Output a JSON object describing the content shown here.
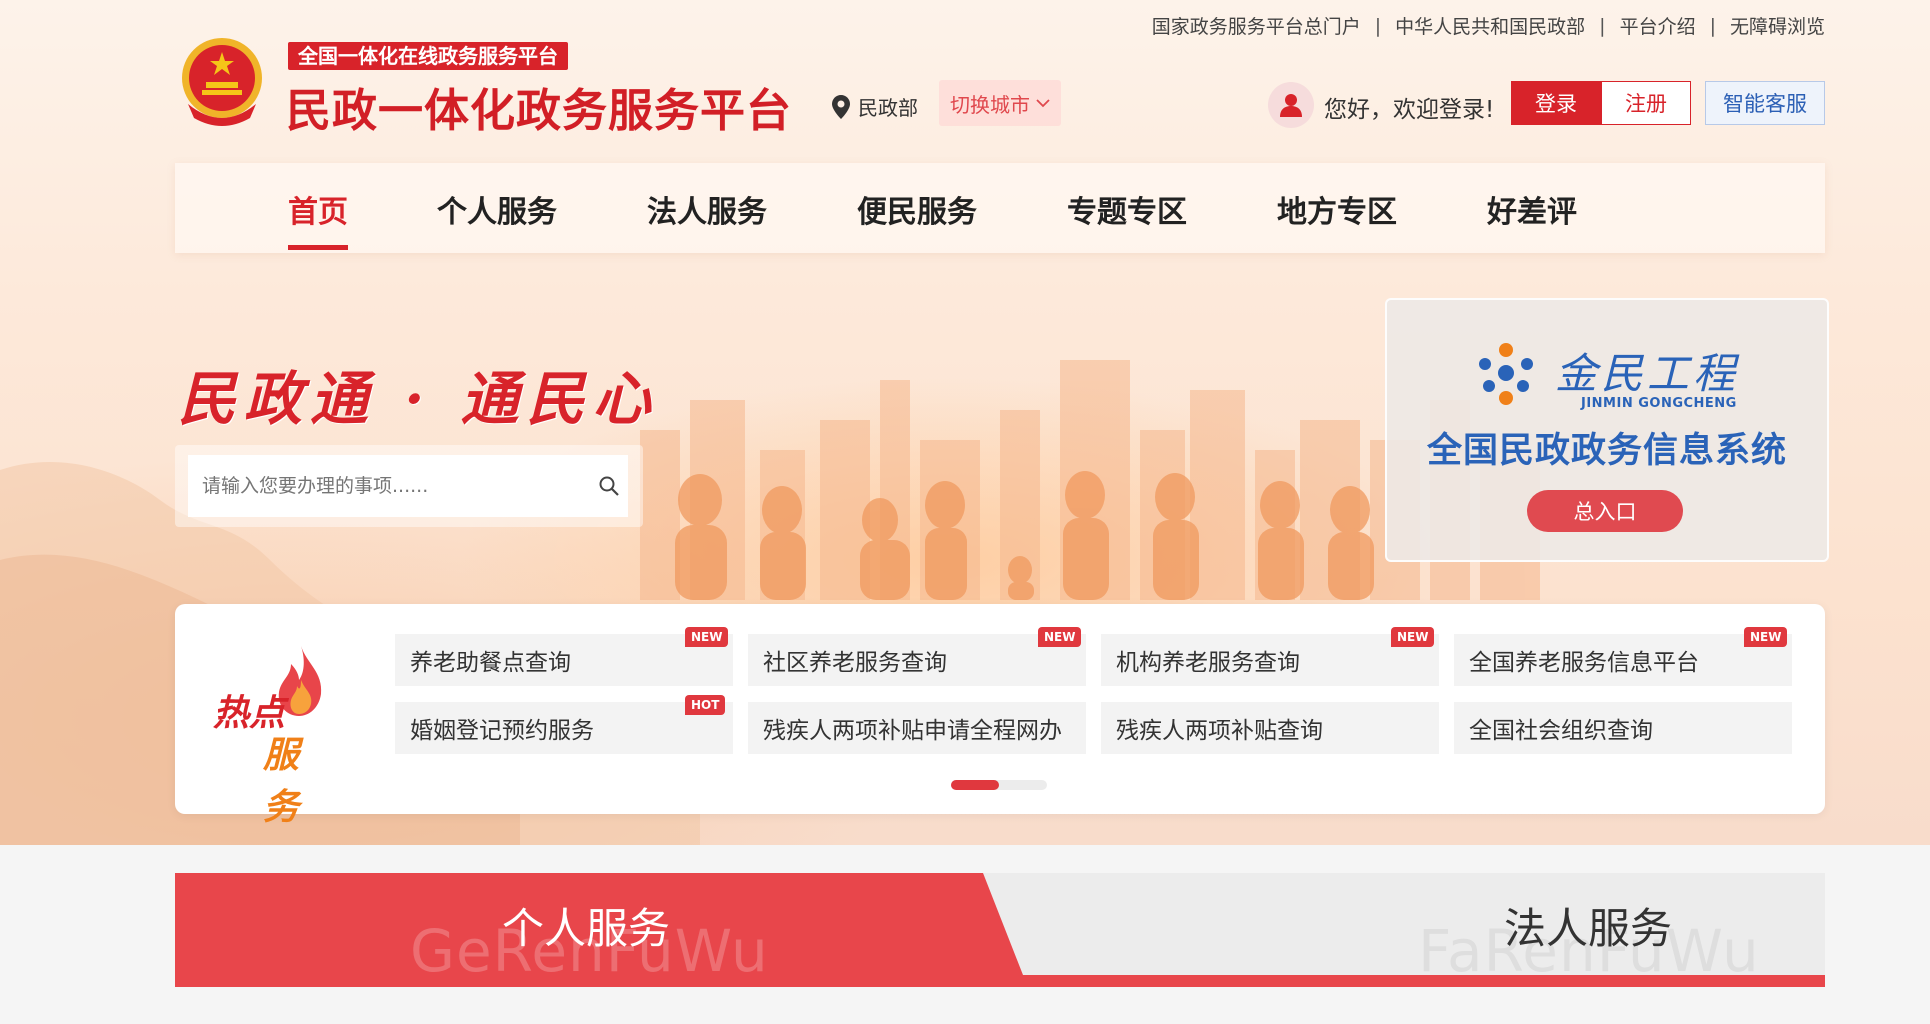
{
  "top_links": [
    "国家政务服务平台总门户",
    "中华人民共和国民政部",
    "平台介绍",
    "无障碍浏览"
  ],
  "header": {
    "sub_tag": "全国一体化在线政务服务平台",
    "title": "民政一体化政务服务平台",
    "location": "民政部",
    "switch_city": "切换城市",
    "greeting": "您好，欢迎登录!",
    "login": "登录",
    "register": "注册",
    "smart_service": "智能客服"
  },
  "nav": {
    "items": [
      "首页",
      "个人服务",
      "法人服务",
      "便民服务",
      "专题专区",
      "地方专区",
      "好差评"
    ],
    "active": "首页"
  },
  "hero": {
    "slogan": "民政通 · 通民心",
    "search_placeholder": "请输入您要办理的事项......"
  },
  "jinmin_banner": {
    "logo_cn": "金民工程",
    "logo_en": "JINMIN GONGCHENG",
    "system": "全国民政政务信息系统",
    "entry": "总入口",
    "brand_color": "#2a63b8"
  },
  "hot_services": {
    "badge_line1": "热点",
    "badge_line2": "服务",
    "items": [
      {
        "label": "养老助餐点查询",
        "tag": "NEW"
      },
      {
        "label": "社区养老服务查询",
        "tag": "NEW"
      },
      {
        "label": "机构养老服务查询",
        "tag": "NEW"
      },
      {
        "label": "全国养老服务信息平台",
        "tag": "NEW"
      },
      {
        "label": "婚姻登记预约服务",
        "tag": "HOT"
      },
      {
        "label": "残疾人两项补贴申请全程网办",
        "tag": ""
      },
      {
        "label": "残疾人两项补贴查询",
        "tag": ""
      },
      {
        "label": "全国社会组织查询",
        "tag": ""
      }
    ]
  },
  "service_tabs": [
    {
      "label": "个人服务",
      "ghost": "GeRenFuWu",
      "active": true
    },
    {
      "label": "法人服务",
      "ghost": "FaRenFuWu",
      "active": false
    }
  ],
  "colors": {
    "accent": "#d8232a",
    "tag": "#e0383e",
    "link_blue": "#2b5fb5"
  }
}
